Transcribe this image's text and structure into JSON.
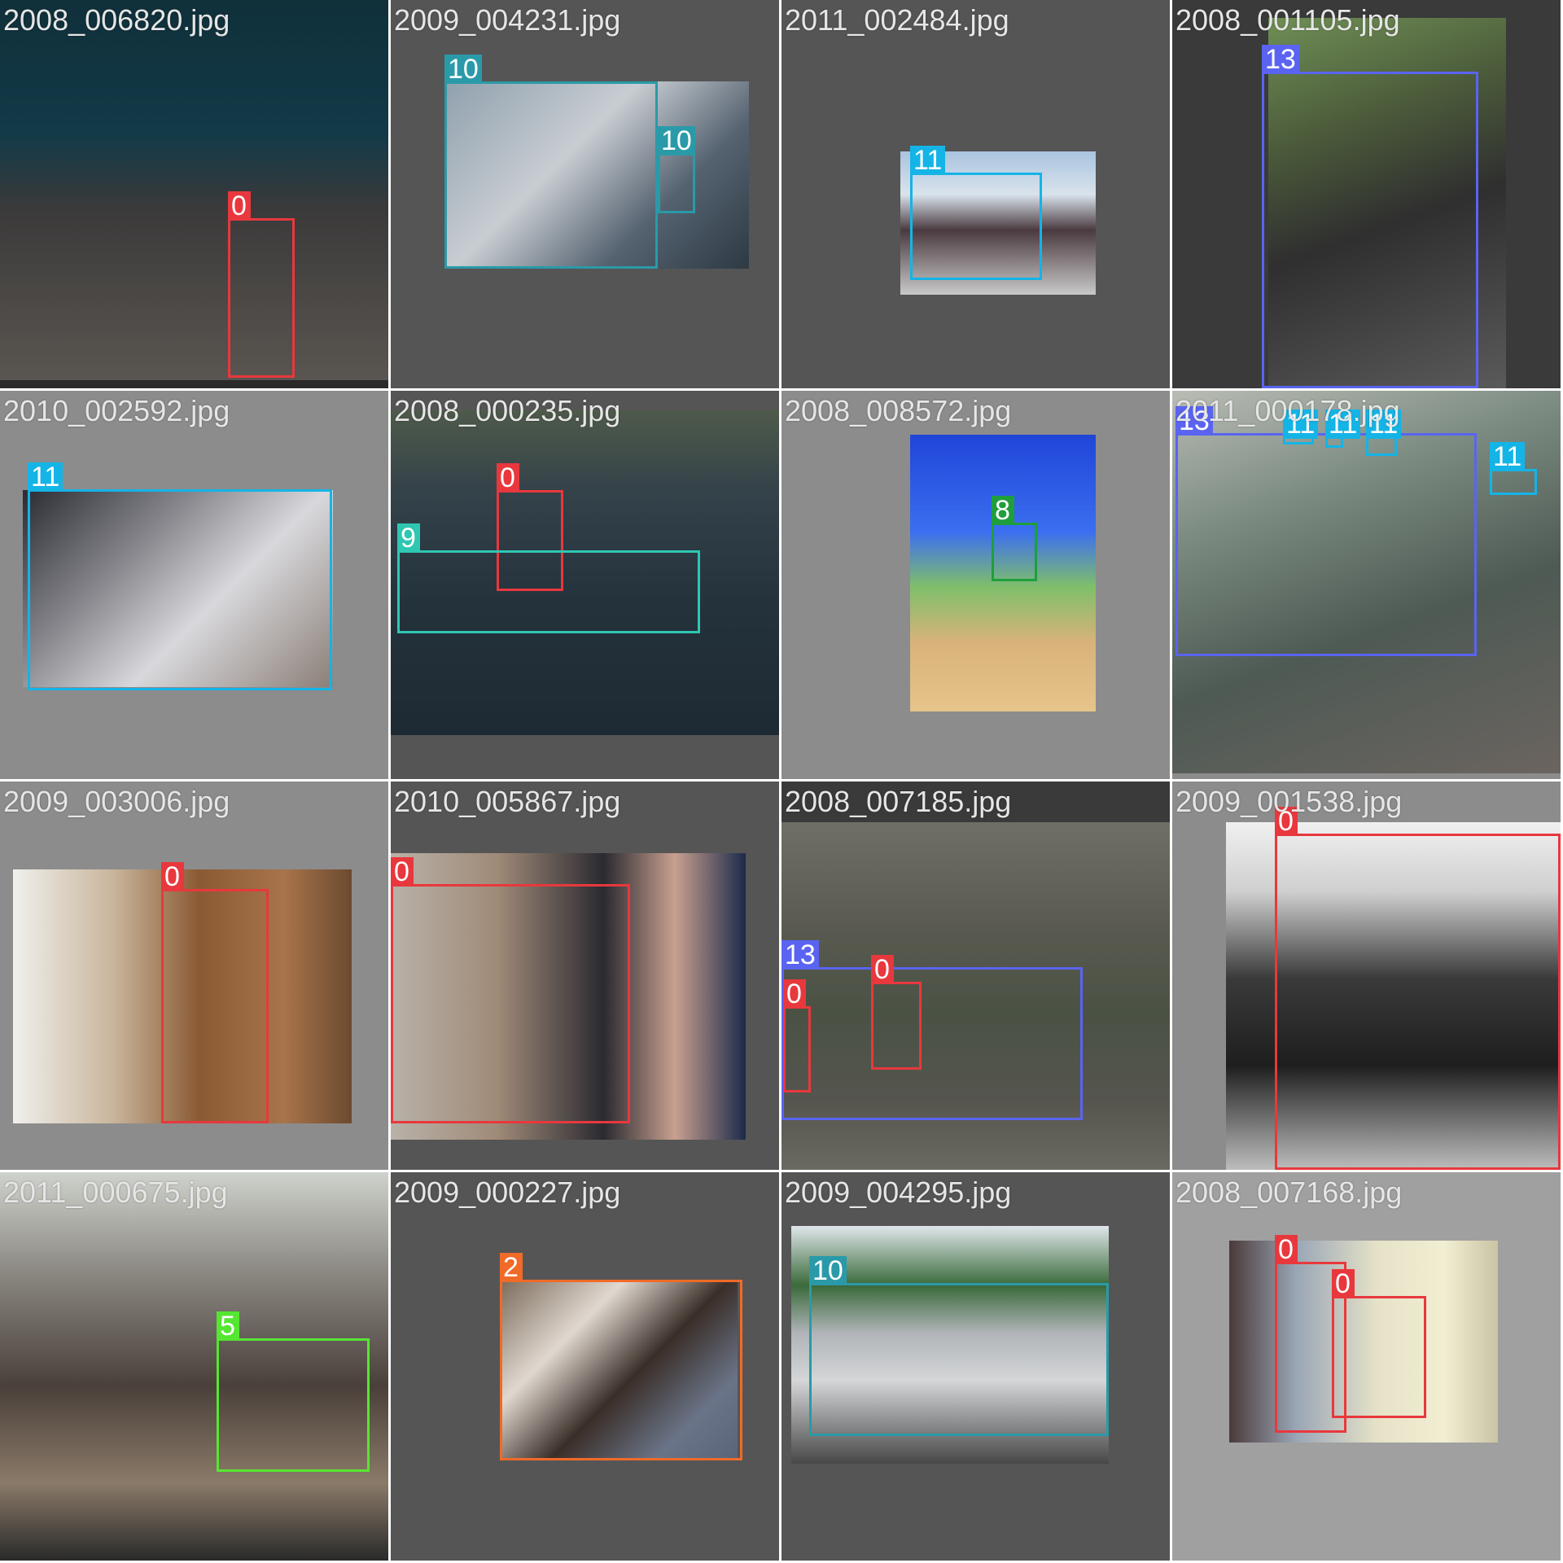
{
  "title": "",
  "class_colors": {
    "0": "#e8383d",
    "2": "#f06a28",
    "5": "#55e632",
    "8": "#1f9e3c",
    "9": "#2ec7b2",
    "10": "#2a9aa8",
    "11": "#14b4e6",
    "13": "#5a64f0"
  },
  "tiles": [
    {
      "filename": "2008_006820.jpg",
      "labels": [
        "0"
      ]
    },
    {
      "filename": "2009_004231.jpg",
      "labels": [
        "10",
        "10"
      ]
    },
    {
      "filename": "2011_002484.jpg",
      "labels": [
        "11"
      ]
    },
    {
      "filename": "2008_001105.jpg",
      "labels": [
        "13"
      ]
    },
    {
      "filename": "2010_002592.jpg",
      "labels": [
        "11"
      ]
    },
    {
      "filename": "2008_000235.jpg",
      "labels": [
        "0",
        "9"
      ]
    },
    {
      "filename": "2008_008572.jpg",
      "labels": [
        "8"
      ]
    },
    {
      "filename": "2011_000178.jpg",
      "labels": [
        "13",
        "11",
        "11",
        "11",
        "11",
        "11"
      ]
    },
    {
      "filename": "2009_003006.jpg",
      "labels": [
        "0"
      ]
    },
    {
      "filename": "2010_005867.jpg",
      "labels": [
        "0"
      ]
    },
    {
      "filename": "2008_007185.jpg",
      "labels": [
        "13",
        "0",
        "0"
      ]
    },
    {
      "filename": "2009_001538.jpg",
      "labels": [
        "0"
      ]
    },
    {
      "filename": "2011_000675.jpg",
      "labels": [
        "5"
      ]
    },
    {
      "filename": "2009_000227.jpg",
      "labels": [
        "2"
      ]
    },
    {
      "filename": "2009_004295.jpg",
      "labels": [
        "10"
      ]
    },
    {
      "filename": "2008_007168.jpg",
      "labels": [
        "0",
        "0"
      ]
    }
  ]
}
